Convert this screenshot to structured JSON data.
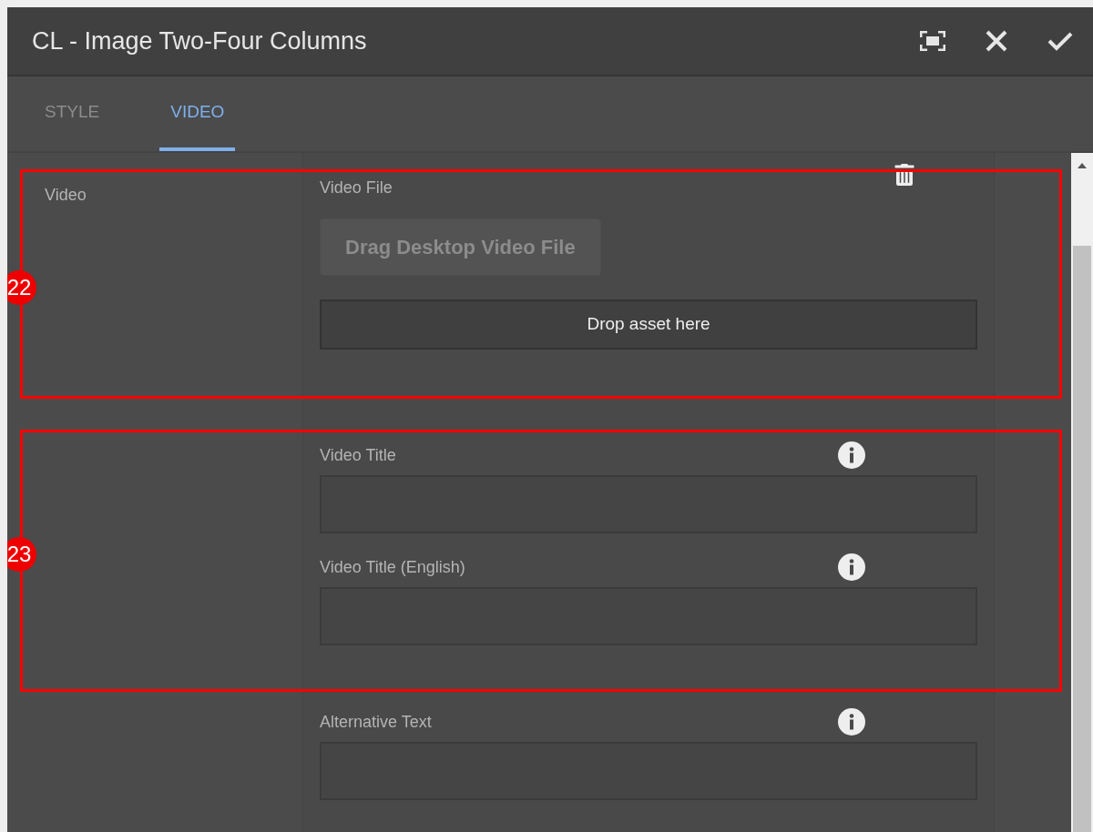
{
  "dialog": {
    "title": "CL - Image Two-Four Columns"
  },
  "tabs": [
    {
      "label": "STYLE",
      "selected": false
    },
    {
      "label": "VIDEO",
      "selected": true
    }
  ],
  "groups": [
    {
      "side_label": "Video",
      "annotation": "22",
      "fields": [
        {
          "kind": "file",
          "label": "Video File",
          "button": "Drag Desktop Video File",
          "disabled": true,
          "drop": "Drop asset here"
        }
      ]
    },
    {
      "annotation": "23",
      "fields": [
        {
          "kind": "text",
          "label": "Video Title"
        },
        {
          "kind": "text",
          "label": "Video Title (English)"
        }
      ]
    },
    {
      "fields": [
        {
          "kind": "text",
          "label": "Alternative Text"
        }
      ]
    }
  ]
}
